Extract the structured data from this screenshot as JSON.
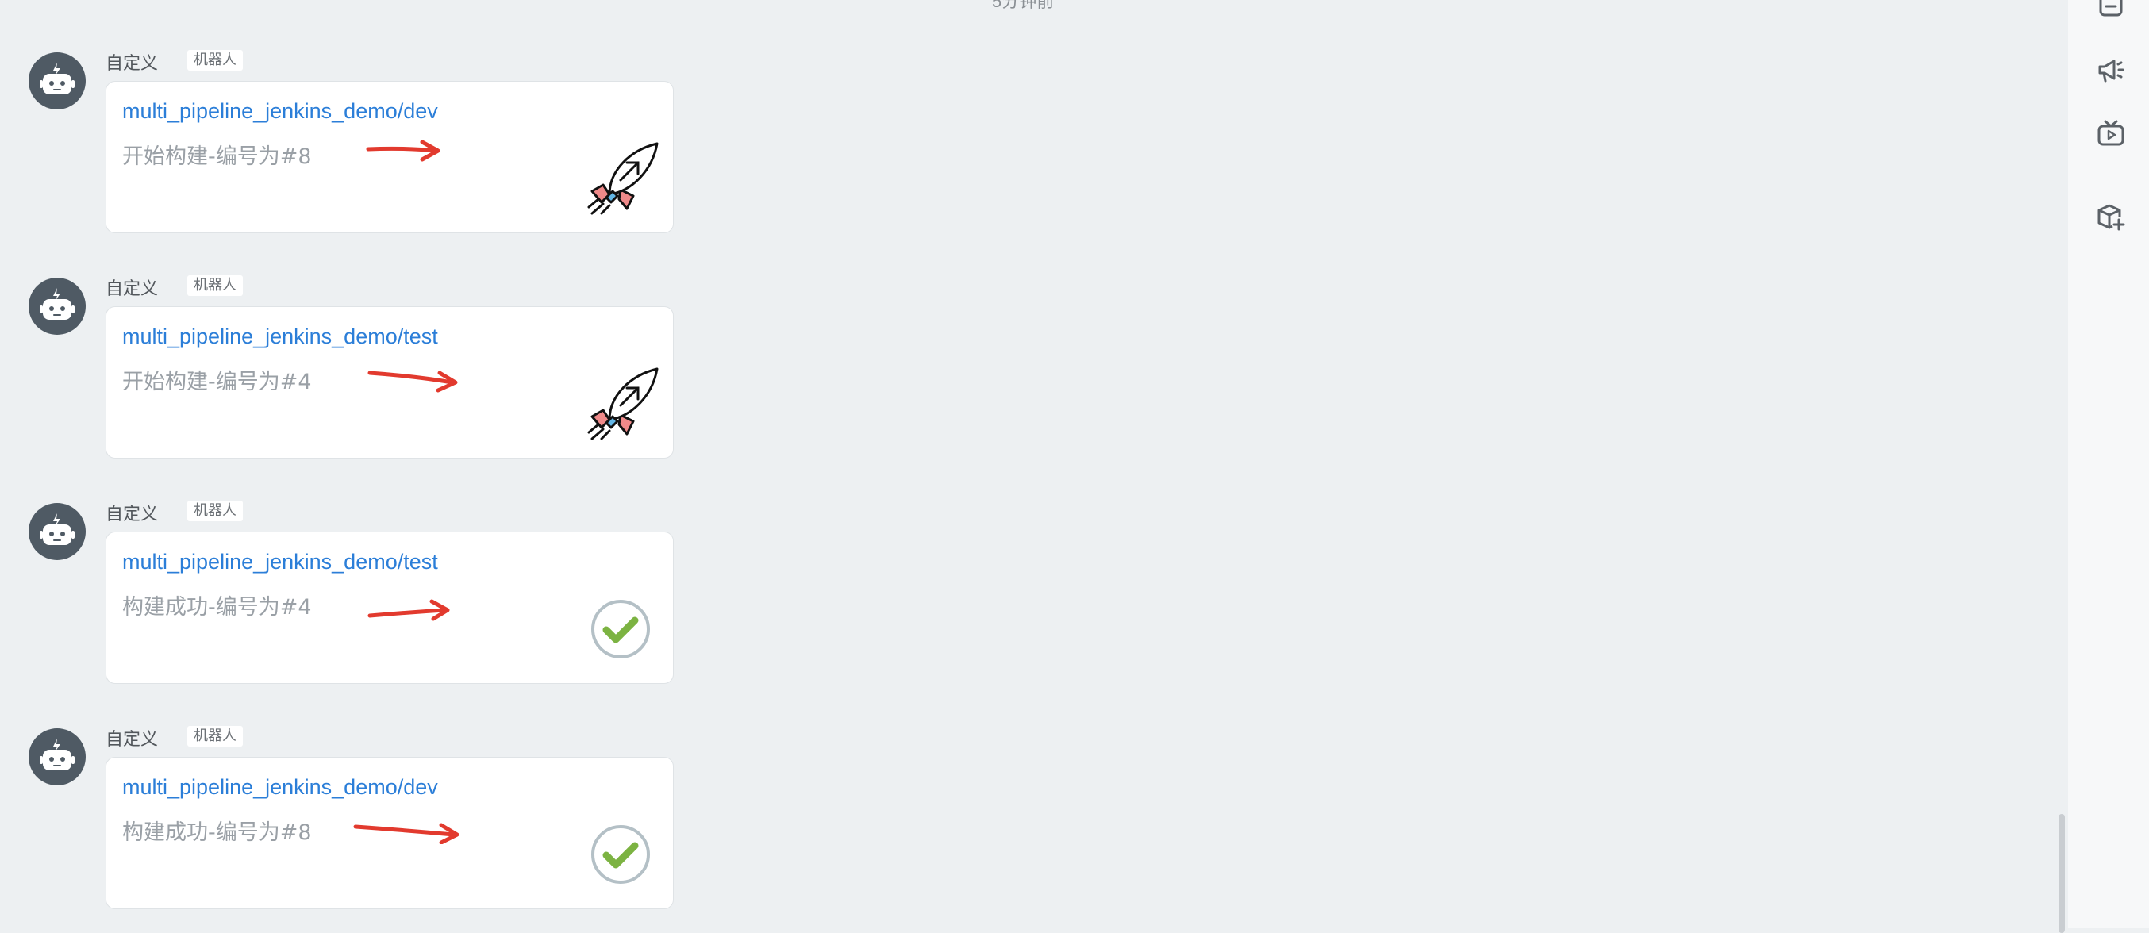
{
  "top_timestamp": "5分钟前",
  "messages": [
    {
      "sender": "自定义",
      "badge": "机器人",
      "title": "multi_pipeline_jenkins_demo/dev",
      "desc": "开始构建-编号为#8",
      "status_icon": "rocket-icon"
    },
    {
      "sender": "自定义",
      "badge": "机器人",
      "title": "multi_pipeline_jenkins_demo/test",
      "desc": "开始构建-编号为#4",
      "status_icon": "rocket-icon"
    },
    {
      "sender": "自定义",
      "badge": "机器人",
      "title": "multi_pipeline_jenkins_demo/test",
      "desc": "构建成功-编号为#4",
      "status_icon": "success-check-icon"
    },
    {
      "sender": "自定义",
      "badge": "机器人",
      "title": "multi_pipeline_jenkins_demo/dev",
      "desc": "构建成功-编号为#8",
      "status_icon": "success-check-icon"
    }
  ],
  "right_sidebar": {
    "icons": [
      "note-icon",
      "megaphone-icon",
      "video-icon",
      "add-package-icon"
    ]
  },
  "colors": {
    "background": "#edf0f2",
    "link": "#2b7ed8",
    "annotation_arrow": "#e23a2e",
    "success": "#7cb342",
    "avatar": "#4f5a64"
  }
}
